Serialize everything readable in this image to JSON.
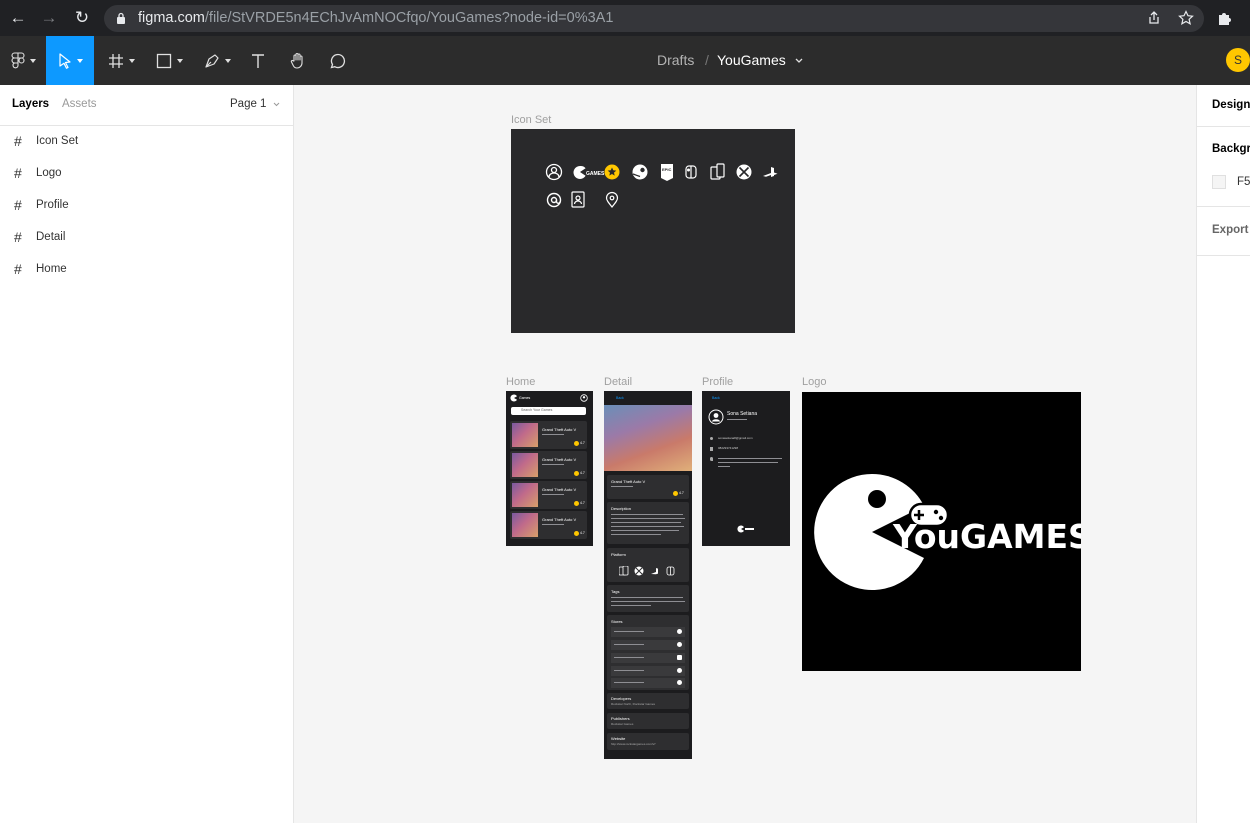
{
  "browser": {
    "url_host": "figma.com",
    "url_path": "/file/StVRDE5n4EChJvAmNOCfqo/YouGames?node-id=0%3A1"
  },
  "toolbar": {
    "breadcrumb_parent": "Drafts",
    "breadcrumb_separator": "/",
    "file_name": "YouGames",
    "avatar_initial": "S",
    "accent_color": "#0d99ff"
  },
  "left_panel": {
    "tabs": [
      "Layers",
      "Assets"
    ],
    "page_selector": "Page 1",
    "layers": [
      "Icon Set",
      "Logo",
      "Profile",
      "Detail",
      "Home"
    ]
  },
  "canvas": {
    "frames": {
      "icon_set": "Icon Set",
      "home": "Home",
      "detail": "Detail",
      "profile": "Profile",
      "logo": "Logo"
    },
    "logo_text": "YouGAMES",
    "mini": {
      "home_brand": "Games",
      "search_placeholder": "Search Your Games",
      "game_title": "Grand Theft Auto V",
      "rating": "4.7",
      "back": "Back",
      "description_heading": "Description",
      "platform_heading": "Platform",
      "tags_heading": "Tags",
      "stores_heading": "Stores",
      "developers_heading": "Developers",
      "developers_value": "Rockstar North, Rockstar Games",
      "publishers_heading": "Publishers",
      "publishers_value": "Rockstar Games",
      "website_heading": "Website",
      "website_value": "http://www.rockstargames.com/V/",
      "profile_name": "Sona Setiana",
      "profile_email": "sonasetiana8@gmail.com",
      "profile_phone": "082293741298"
    }
  },
  "right_panel": {
    "tab_design": "Design",
    "background_label": "Backgro",
    "background_value": "F5",
    "export_label": "Export"
  }
}
